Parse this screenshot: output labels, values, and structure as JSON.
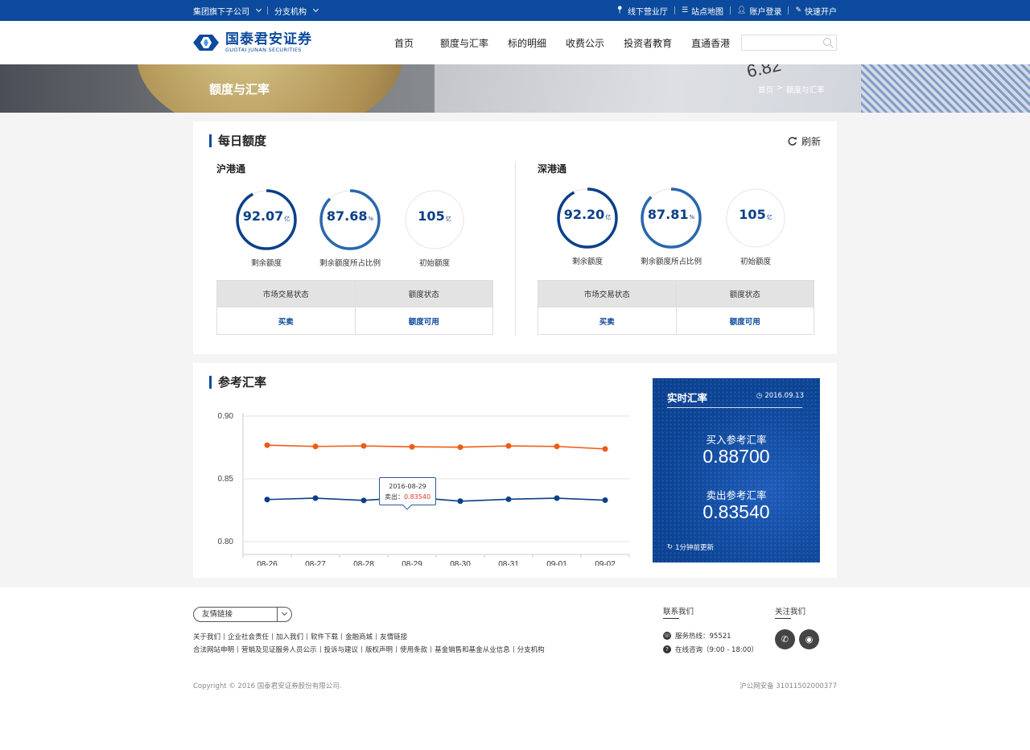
{
  "topbar": {
    "group_dropdown": "集团旗下子公司",
    "branch_dropdown": "分支机构",
    "offline_hall": "线下营业厅",
    "site_map": "站点地图",
    "login": "账户登录",
    "open_account": "快速开户"
  },
  "header": {
    "logo_cn": "国泰君安证券",
    "logo_en": "GUOTAI JUNAN SECURITIES",
    "nav": [
      "首页",
      "额度与汇率",
      "标的明细",
      "收费公示",
      "投资者教育",
      "直通香港"
    ],
    "search_placeholder": ""
  },
  "banner": {
    "title": "额度与汇率",
    "breadcrumb_home": "首页",
    "breadcrumb_sep": ">",
    "breadcrumb_current": "额度与汇率",
    "bg_number": "6.82"
  },
  "daily": {
    "title": "每日额度",
    "refresh": "刷新",
    "markets": [
      {
        "name": "沪港通",
        "gauges": [
          {
            "value": "92.07",
            "unit": "亿",
            "label": "剩余额度",
            "fill": 0.9207
          },
          {
            "value": "87.68",
            "unit": "%",
            "label": "剩余额度所占比例",
            "fill": 0.8768
          },
          {
            "value": "105",
            "unit": "亿",
            "label": "初始额度",
            "fill": 0
          }
        ],
        "table": {
          "h1": "市场交易状态",
          "h2": "额度状态",
          "v1": "买卖",
          "v2": "额度可用"
        }
      },
      {
        "name": "深港通",
        "gauges": [
          {
            "value": "92.20",
            "unit": "亿",
            "label": "剩余额度",
            "fill": 0.922
          },
          {
            "value": "87.81",
            "unit": "%",
            "label": "剩余额度所占比例",
            "fill": 0.8781
          },
          {
            "value": "105",
            "unit": "亿",
            "label": "初始额度",
            "fill": 0
          }
        ],
        "table": {
          "h1": "市场交易状态",
          "h2": "额度状态",
          "v1": "买卖",
          "v2": "额度可用"
        }
      }
    ]
  },
  "rates": {
    "title": "参考汇率",
    "tooltip": {
      "date": "2016-08-29",
      "label": "卖出：",
      "value": "0.83540"
    },
    "realtime": {
      "title": "实时汇率",
      "date": "2016.09.13",
      "buy_label": "买入参考汇率",
      "buy_value": "0.88700",
      "sell_label": "卖出参考汇率",
      "sell_value": "0.83540",
      "updated": "1分钟前更新"
    }
  },
  "chart_data": {
    "type": "line",
    "categories": [
      "08-26",
      "08-27",
      "08-28",
      "08-29",
      "08-30",
      "08-31",
      "09-01",
      "09-02"
    ],
    "series": [
      {
        "values": [
          0.8768,
          0.8758,
          0.8762,
          0.8755,
          0.8752,
          0.8762,
          0.8758,
          0.8738
        ],
        "color": "#f05a14"
      },
      {
        "values": [
          0.8335,
          0.8346,
          0.8328,
          0.8354,
          0.8322,
          0.8337,
          0.8346,
          0.833
        ],
        "color": "#0b3f88"
      }
    ],
    "yticks": [
      "0.90",
      "0.85",
      "0.80"
    ],
    "ylim": [
      0.8,
      0.9
    ],
    "grid": true
  },
  "footer": {
    "friend_links": "友情链接",
    "links_row1": [
      "关于我们",
      "企业社会责任",
      "加入我们",
      "软件下载",
      "金融商城",
      "友情链接"
    ],
    "links_row2": [
      "合法网站申明",
      "营销及见证服务人员公示",
      "投诉与建议",
      "版权声明",
      "使用条款",
      "基金销售和基金从业信息",
      "分支机构"
    ],
    "contact_title": "联系我们",
    "hotline": "服务热线：95521",
    "online": "在线咨询（9:00 - 18:00）",
    "follow_title": "关注我们",
    "copyright": "Copyright © 2016 国泰君安证券股份有限公司.",
    "beian": "沪公网安备 31011502000377"
  },
  "colors": {
    "brand": "#0b4a9c",
    "orange": "#f05a14",
    "navy": "#0b3f88"
  }
}
